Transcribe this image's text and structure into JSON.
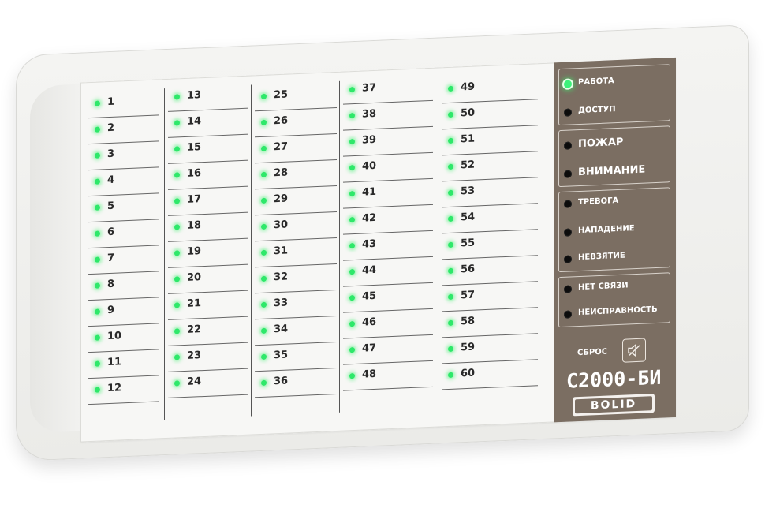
{
  "zones": [
    [
      "1",
      "2",
      "3",
      "4",
      "5",
      "6",
      "7",
      "8",
      "9",
      "10",
      "11",
      "12"
    ],
    [
      "13",
      "14",
      "15",
      "16",
      "17",
      "18",
      "19",
      "20",
      "21",
      "22",
      "23",
      "24"
    ],
    [
      "25",
      "26",
      "27",
      "28",
      "29",
      "30",
      "31",
      "32",
      "33",
      "34",
      "35",
      "36"
    ],
    [
      "37",
      "38",
      "39",
      "40",
      "41",
      "42",
      "43",
      "44",
      "45",
      "46",
      "47",
      "48"
    ],
    [
      "49",
      "50",
      "51",
      "52",
      "53",
      "54",
      "55",
      "56",
      "57",
      "58",
      "59",
      "60"
    ]
  ],
  "status": {
    "work": "РАБОТА",
    "access": "ДОСТУП",
    "fire": "ПОЖАР",
    "attention": "ВНИМАНИЕ",
    "alarm": "ТРЕВОГА",
    "attack": "НАПАДЕНИЕ",
    "not_armed": "НЕВЗЯТИЕ",
    "no_link": "НЕТ СВЯЗИ",
    "fault": "НЕИСПРАВНОСТЬ"
  },
  "reset_label": "СБРОС",
  "model": "С2000-БИ",
  "brand": "BOLID",
  "colors": {
    "led_on": "#2ee86a",
    "side_panel": "#7b6e62",
    "housing": "#eeeeeb"
  },
  "icons": {
    "reset": "mute-speaker-icon"
  }
}
